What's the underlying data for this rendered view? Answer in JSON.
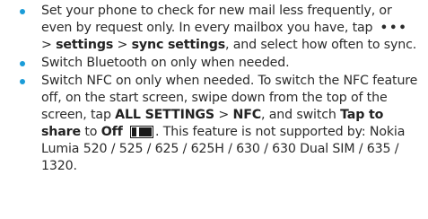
{
  "items": [
    {
      "t1": "Set your phone to check for new mail less frequently, or even by request only. In every mailbox you have, tap",
      "dots": "•••",
      "sep1": ">",
      "b1": "settings",
      "sep2": ">",
      "b2": "sync settings",
      "t2": ", and select how often to sync."
    },
    {
      "text": "Switch Bluetooth on only when needed."
    },
    {
      "t1": "Switch NFC on only when needed. To switch the NFC feature off, on the start screen, swipe down from the top of the screen, tap",
      "b1": "ALL SETTINGS",
      "sep1": ">",
      "b2": "NFC",
      "t2": ", and switch",
      "b3": "Tap to share",
      "t3": "to",
      "b4": "Off",
      "t4": ". This feature is not supported by: Nokia Lumia 520 / 525 / 625 / 625H / 630 / 630 Dual SIM / 635 / 1320."
    }
  ],
  "colors": {
    "bullet": "#1a9cd8",
    "text": "#2b2b2b"
  },
  "icons": [
    "more-dots-icon",
    "toggle-off-icon"
  ]
}
